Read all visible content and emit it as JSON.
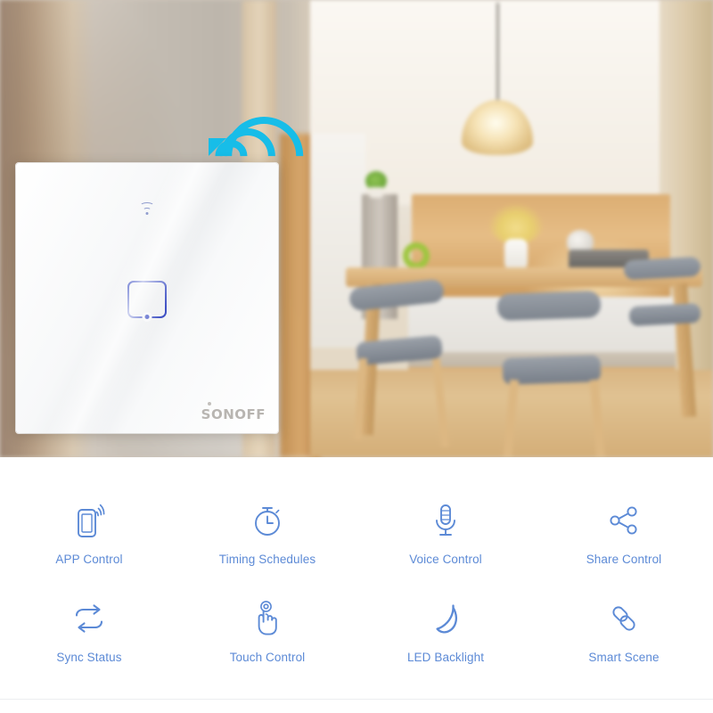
{
  "hero": {
    "alt": "SONOFF smart wall touch switch installed on wall in front of a blurred modern kitchen with dining table",
    "wifi_signal_icon": "wifi-broadcast-icon",
    "wifi_signal_color": "#17bde8",
    "panel": {
      "brand_label": "SONOFF",
      "status_icon": "wifi-indicator-icon",
      "touch_key_icon": "touch-key-outline-icon",
      "key_count": 1,
      "accent_color": "#3f51c4",
      "panel_color": "#f7f8f9"
    }
  },
  "features": {
    "label_color": "#5c8ad6",
    "rows": [
      [
        {
          "icon": "phone-signal-icon",
          "label": "APP Control"
        },
        {
          "icon": "stopwatch-icon",
          "label": "Timing Schedules"
        },
        {
          "icon": "microphone-icon",
          "label": "Voice Control"
        },
        {
          "icon": "share-nodes-icon",
          "label": "Share Control"
        }
      ],
      [
        {
          "icon": "sync-arrows-icon",
          "label": "Sync Status"
        },
        {
          "icon": "hand-tap-icon",
          "label": "Touch Control"
        },
        {
          "icon": "crescent-moon-icon",
          "label": "LED Backlight"
        },
        {
          "icon": "chain-link-icon",
          "label": "Smart Scene"
        }
      ]
    ]
  }
}
